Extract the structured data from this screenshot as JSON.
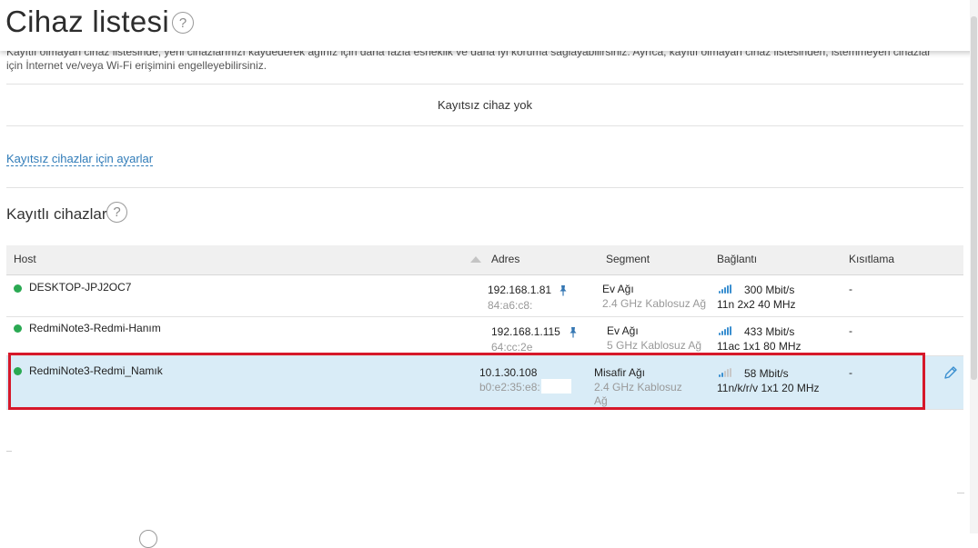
{
  "page": {
    "title": "Cihaz listesi",
    "help_glyph": "?"
  },
  "unregistered": {
    "description": "Kayıtlı olmayan cihaz listesinde, yeni cihazlarınızı kaydederek ağınız için daha fazla esneklik ve daha iyi koruma sağlayabilirsiniz. Ayrıca, kayıtlı olmayan cihaz listesinden, istemmeyen cihazlar için İnternet ve/veya Wi-Fi erişimini engelleyebilirsiniz.",
    "empty_text": "Kayıtsız cihaz yok",
    "settings_link": "Kayıtsız cihazlar için ayarlar"
  },
  "registered": {
    "title": "Kayıtlı cihazlar",
    "columns": {
      "host": "Host",
      "address": "Adres",
      "segment": "Segment",
      "connection": "Bağlantı",
      "restriction": "Kısıtlama"
    },
    "rows": [
      {
        "host": "DESKTOP-JPJ2OC7",
        "ip": "192.168.1.81",
        "mac": "84:a6:c8:",
        "segment": "Ev Ağı",
        "segment_sub": "2.4 GHz Kablosuz Ağ",
        "speed": "300 Mbit/s",
        "mode": "11n 2x2 40 MHz",
        "restriction": "-",
        "signal_bars": 4,
        "pinned": true,
        "status_color": "#2aa952"
      },
      {
        "host": "RedmiNote3-Redmi-Hanım",
        "ip": "192.168.1.115",
        "mac": "64:cc:2e",
        "segment": "Ev Ağı",
        "segment_sub": "5 GHz Kablosuz Ağ",
        "speed": "433 Mbit/s",
        "mode": "11ac 1x1 80 MHz",
        "restriction": "-",
        "signal_bars": 4,
        "pinned": true,
        "status_color": "#2aa952"
      },
      {
        "host": "RedmiNote3-Redmi_Namık",
        "ip": "10.1.30.108",
        "mac": "b0:e2:35:e8:",
        "segment": "Misafir Ağı",
        "segment_sub": "2.4 GHz Kablosuz Ağ",
        "speed": "58 Mbit/s",
        "mode": "11n/k/r/v 1x1 20 MHz",
        "restriction": "-",
        "signal_bars": 2,
        "pinned": false,
        "status_color": "#2aa952"
      }
    ]
  },
  "icons": {
    "help": "help-circle-icon",
    "sort": "sort-ascending-icon",
    "pin": "pin-icon",
    "signal": "signal-strength-icon",
    "edit": "pencil-edit-icon"
  },
  "colors": {
    "accent": "#2f7bb8",
    "signal_on": "#3a8fd0",
    "signal_off": "#c8c8c8",
    "selected_row": "#d9ecf7",
    "highlight_border": "#d6182a",
    "online_dot": "#2aa952"
  }
}
